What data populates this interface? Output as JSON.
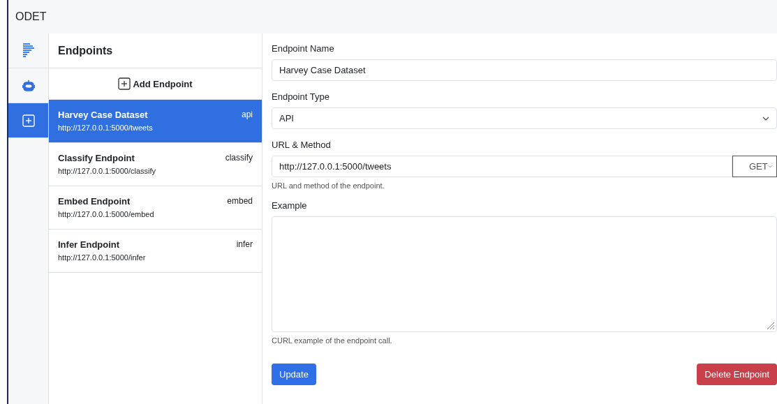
{
  "app": {
    "title": "ODET"
  },
  "rail": [
    {
      "kind": "lines",
      "selected": false
    },
    {
      "kind": "robot",
      "selected": false
    },
    {
      "kind": "plus",
      "selected": true
    }
  ],
  "endpoints": {
    "title": "Endpoints",
    "add_label": "Add Endpoint",
    "items": [
      {
        "name": "Harvey Case Dataset",
        "url": "http://127.0.0.1:5000/tweets",
        "type": "api",
        "selected": true
      },
      {
        "name": "Classify Endpoint",
        "url": "http://127.0.0.1:5000/classify",
        "type": "classify",
        "selected": false
      },
      {
        "name": "Embed Endpoint",
        "url": "http://127.0.0.1:5000/embed",
        "type": "embed",
        "selected": false
      },
      {
        "name": "Infer Endpoint",
        "url": "http://127.0.0.1:5000/infer",
        "type": "infer",
        "selected": false
      }
    ]
  },
  "form": {
    "name_label": "Endpoint Name",
    "name_value": "Harvey Case Dataset",
    "type_label": "Endpoint Type",
    "type_value": "API",
    "url_label": "URL & Method",
    "url_value": "http://127.0.0.1:5000/tweets",
    "method_value": "GET",
    "url_help": "URL and method of the endpoint.",
    "example_label": "Example",
    "example_help": "CURL example of the endpoint call.",
    "update_button": "Update",
    "delete_button": "Delete Endpoint"
  }
}
